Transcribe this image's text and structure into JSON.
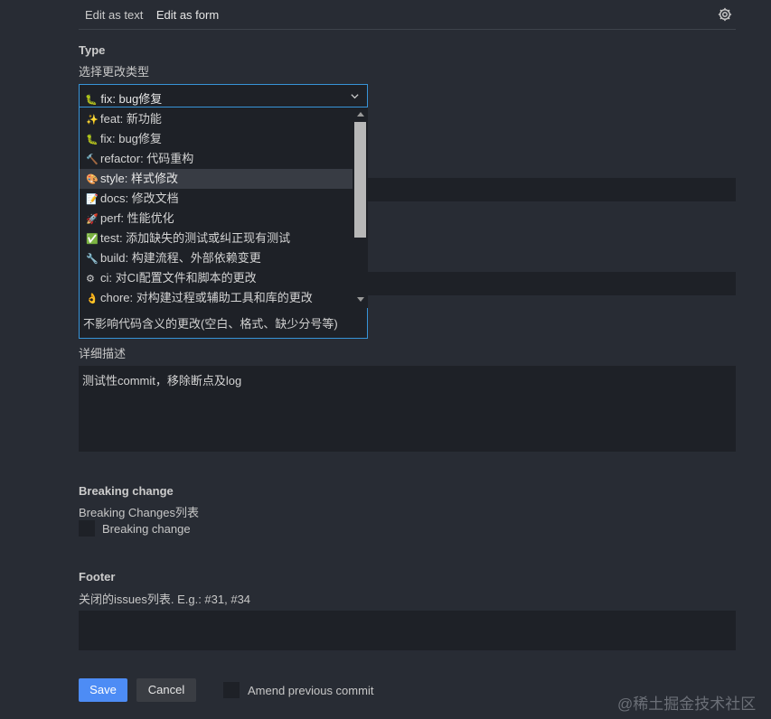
{
  "tabs": {
    "text": "Edit as text",
    "form": "Edit as form"
  },
  "type_section": {
    "title": "Type",
    "description": "选择更改类型",
    "selected_emoji": "🐛",
    "selected": "fix: bug修复",
    "options": [
      {
        "emoji": "✨",
        "label": "feat: 新功能"
      },
      {
        "emoji": "🐛",
        "label": "fix: bug修复"
      },
      {
        "emoji": "🔨",
        "label": "refactor: 代码重构"
      },
      {
        "emoji": "🎨",
        "label": "style: 样式修改"
      },
      {
        "emoji": "📝",
        "label": "docs: 修改文档"
      },
      {
        "emoji": "🚀",
        "label": "perf: 性能优化"
      },
      {
        "emoji": "✅",
        "label": "test: 添加缺失的测试或纠正现有测试"
      },
      {
        "emoji": "🔧",
        "label": "build: 构建流程、外部依赖变更"
      },
      {
        "emoji": "⚙",
        "label": "ci: 对CI配置文件和脚本的更改"
      },
      {
        "emoji": "👌",
        "label": "chore: 对构建过程或辅助工具和库的更改"
      }
    ],
    "hover_description": "不影响代码含义的更改(空白、格式、缺少分号等)"
  },
  "detail_section": {
    "label": "详细描述",
    "value": "测试性commit，移除断点及log"
  },
  "breaking_section": {
    "title": "Breaking change",
    "description": "Breaking Changes列表",
    "checkbox_label": "Breaking change"
  },
  "footer_section": {
    "title": "Footer",
    "description": "关闭的issues列表. E.g.: #31, #34",
    "value": ""
  },
  "actions": {
    "save": "Save",
    "cancel": "Cancel",
    "amend_label": "Amend previous commit"
  },
  "watermark": "@稀土掘金技术社区"
}
